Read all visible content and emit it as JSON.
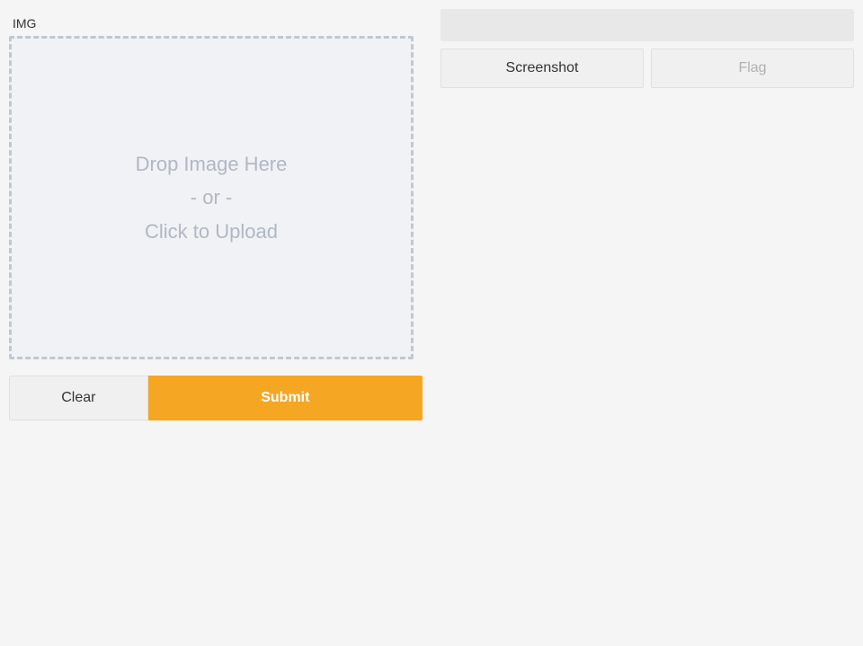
{
  "left": {
    "img_label": "IMG",
    "drop_zone": {
      "line1": "Drop Image Here",
      "line2": "- or -",
      "line3": "Click to Upload"
    },
    "clear_button": "Clear",
    "submit_button": "Submit"
  },
  "right": {
    "tab_screenshot": "Screenshot",
    "tab_flag": "Flag"
  },
  "colors": {
    "submit_bg": "#f5a623",
    "clear_bg": "#f0f0f0",
    "drop_border": "#c0c8d0",
    "drop_bg": "#f0f2f5",
    "drop_text": "#b0b8c4"
  }
}
